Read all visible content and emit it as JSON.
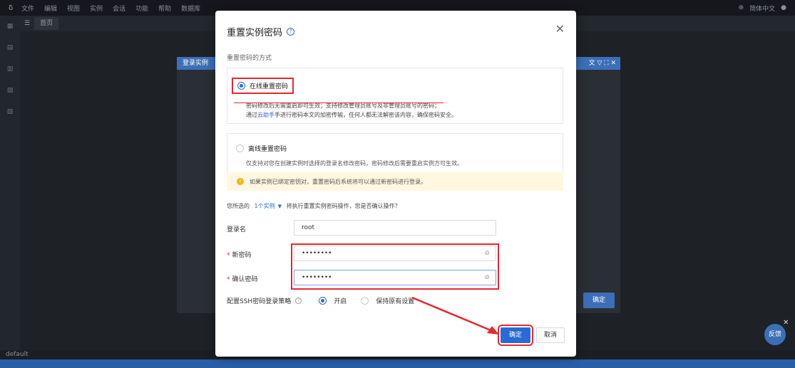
{
  "menubar": {
    "logo": "δ",
    "items": [
      "文件",
      "编辑",
      "视图",
      "实例",
      "会话",
      "功能",
      "帮助",
      "数据库"
    ],
    "lang": "简体中文"
  },
  "tabs": {
    "home": "首页"
  },
  "bg_dialog": {
    "title": "登录实例",
    "confirm": "确定",
    "tools": "文 ▽ ⛶ ✕"
  },
  "bottom": {
    "env": "default",
    "float_label": "反馈"
  },
  "modal": {
    "title": "重置实例密码",
    "method_label": "重置密码的方式",
    "online": {
      "label": "在线重置密码",
      "line1": "密码修改后无需重启即可生效；支持修改管理员账号及非管理员账号的密码；",
      "line2_pre": "通过",
      "line2_link": "云助手",
      "line2_post": "手进行密码本文的加密传输，任何人都无法解密该内容，确保密码安全。"
    },
    "offline": {
      "label": "离线重置密码",
      "line1": "仅支持对您在创建实例时选择的登录名修改密码，密码修改后需要重启实例方可生效。"
    },
    "warning": "如果实例已绑定密钥对，重置密码后系统将可以通过新密码进行登录。",
    "selection": {
      "pre": "您所选的",
      "link": "1个实例",
      "post": "将执行重置实例密码操作，您是否确认操作？"
    },
    "login_label": "登录名",
    "login_value": "root",
    "new_pw_label": "新密码",
    "new_pw_value": "••••••••",
    "confirm_pw_label": "确认密码",
    "confirm_pw_value": "••••••••",
    "ssh_label": "配置SSH密码登录策略",
    "ssh_on": "开启",
    "ssh_keep": "保持原有设置",
    "ok": "确定",
    "cancel": "取消"
  }
}
